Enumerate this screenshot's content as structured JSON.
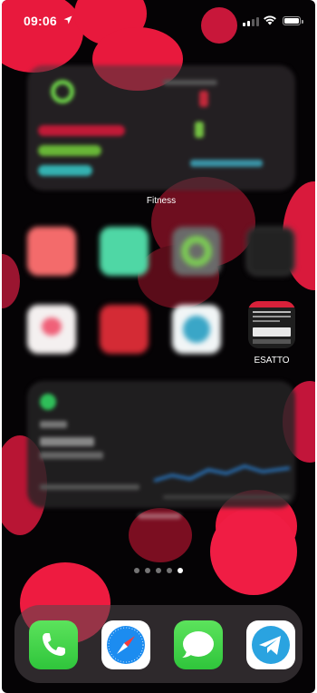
{
  "status_bar": {
    "time": "09:06",
    "signal_bars_active": 2,
    "signal_bars_total": 4,
    "wifi": true,
    "battery_level": 1.0
  },
  "widgets": {
    "fitness": {
      "label": "Fitness"
    },
    "stocks": {
      "label": ""
    }
  },
  "apps": [
    {
      "name": "blurred-app-1",
      "label": "",
      "color": "#e85a5a",
      "row": 1,
      "col": 1
    },
    {
      "name": "blurred-app-2",
      "label": "",
      "color": "#4fd7a5",
      "row": 1,
      "col": 2
    },
    {
      "name": "blurred-app-3",
      "label": "",
      "color": "#7ccd54",
      "row": 1,
      "col": 3
    },
    {
      "name": "blurred-app-4",
      "label": "",
      "color": "#2b2b2b",
      "row": 1,
      "col": 4
    },
    {
      "name": "blurred-app-5",
      "label": "",
      "color": "#f3c7cc",
      "row": 2,
      "col": 1
    },
    {
      "name": "blurred-app-6",
      "label": "",
      "color": "#d42b35",
      "row": 2,
      "col": 2
    },
    {
      "name": "blurred-app-7",
      "label": "",
      "color": "#3aa6c7",
      "row": 2,
      "col": 3
    },
    {
      "name": "esatto-app",
      "label": "ESATTO",
      "row": 2,
      "col": 4
    }
  ],
  "page_dots": {
    "count": 5,
    "active_index": 4
  },
  "dock": [
    {
      "name": "phone-app",
      "icon": "phone-icon",
      "color": "#3fd24a"
    },
    {
      "name": "safari-app",
      "icon": "compass-icon",
      "color": "#ffffff"
    },
    {
      "name": "messages-app",
      "icon": "speech-bubble-icon",
      "color": "#3fd24a"
    },
    {
      "name": "telegram-app",
      "icon": "paper-plane-icon",
      "color": "#ffffff"
    }
  ],
  "colors": {
    "wallpaper_base": "#050305",
    "accent_red": "#e8193d"
  }
}
